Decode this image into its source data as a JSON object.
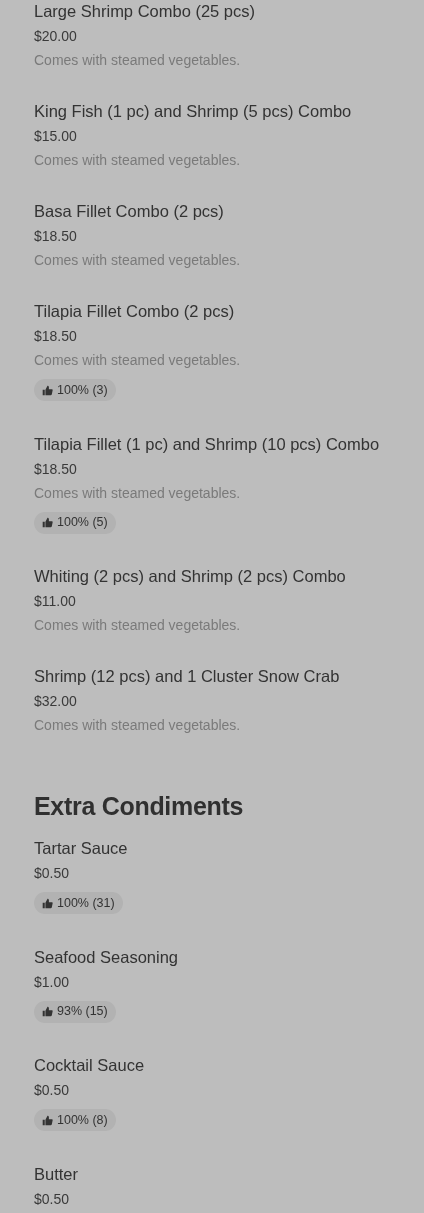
{
  "sections": [
    {
      "items": [
        {
          "name": "Large Shrimp Combo (25 pcs)",
          "price": "$20.00",
          "description": "Comes with steamed vegetables."
        },
        {
          "name": "King Fish (1 pc) and Shrimp (5 pcs) Combo",
          "price": "$15.00",
          "description": "Comes with steamed vegetables."
        },
        {
          "name": "Basa Fillet Combo (2 pcs)",
          "price": "$18.50",
          "description": "Comes with steamed vegetables."
        },
        {
          "name": "Tilapia Fillet Combo (2 pcs)",
          "price": "$18.50",
          "description": "Comes with steamed vegetables.",
          "rating": "100% (3)"
        },
        {
          "name": "Tilapia Fillet (1 pc) and Shrimp (10 pcs) Combo",
          "price": "$18.50",
          "description": "Comes with steamed vegetables.",
          "rating": "100% (5)"
        },
        {
          "name": "Whiting (2 pcs) and Shrimp (2 pcs) Combo",
          "price": "$11.00",
          "description": "Comes with steamed vegetables."
        },
        {
          "name": "Shrimp (12 pcs) and 1 Cluster Snow Crab",
          "price": "$32.00",
          "description": "Comes with steamed vegetables."
        }
      ]
    },
    {
      "title": "Extra Condiments",
      "items": [
        {
          "name": "Tartar Sauce",
          "price": "$0.50",
          "rating": "100% (31)"
        },
        {
          "name": "Seafood Seasoning",
          "price": "$1.00",
          "rating": "93% (15)"
        },
        {
          "name": "Cocktail Sauce",
          "price": "$0.50",
          "rating": "100% (8)"
        },
        {
          "name": "Butter",
          "price": "$0.50"
        }
      ]
    }
  ]
}
